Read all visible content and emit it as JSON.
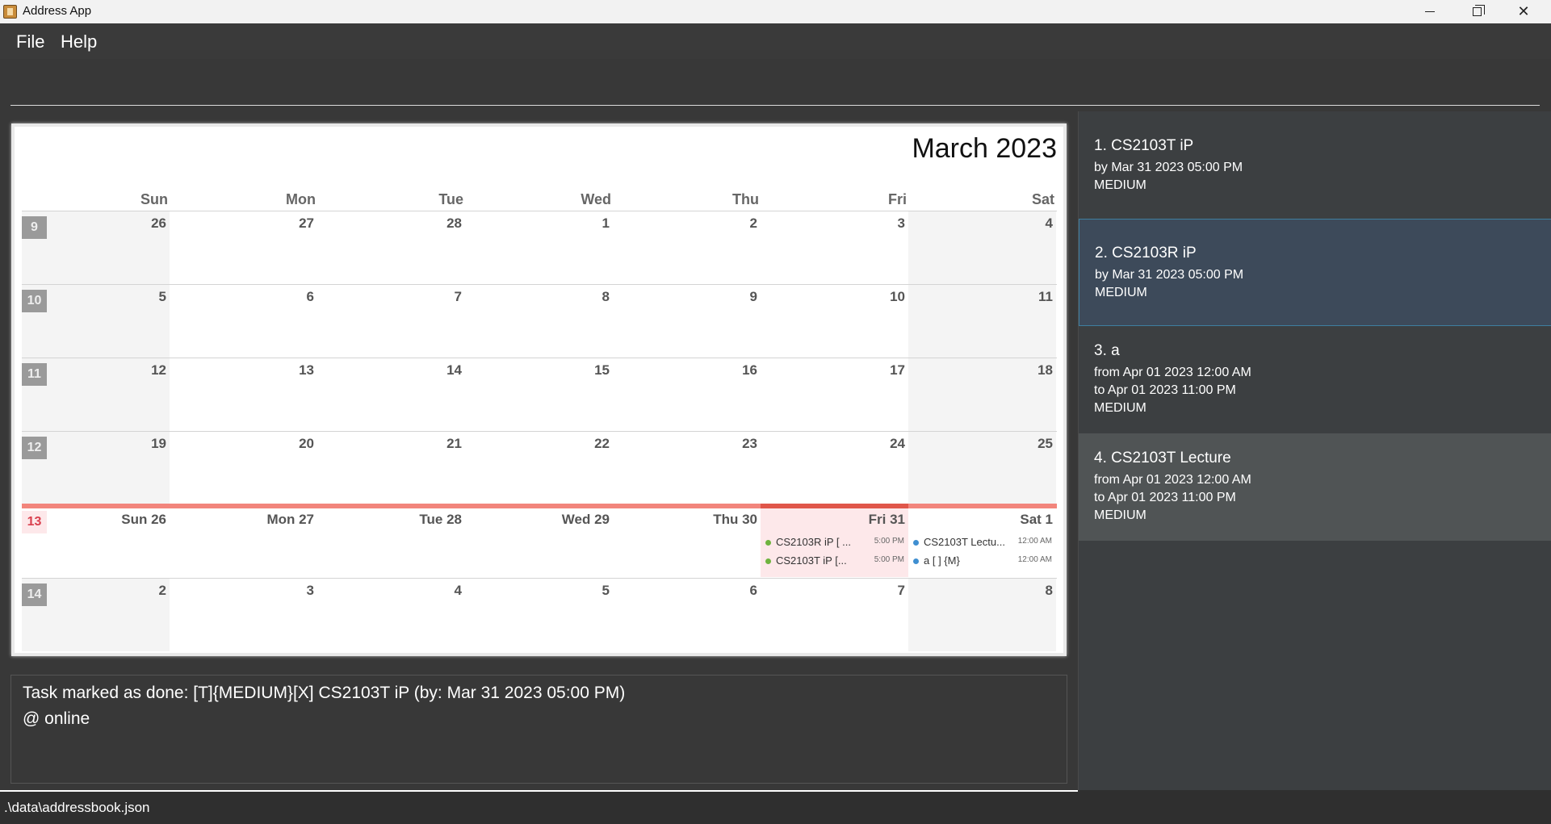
{
  "window": {
    "title": "Address App",
    "minimize_icon": "minimize-icon",
    "maximize_icon": "restore-icon",
    "close_label": "✕"
  },
  "menu": {
    "file": "File",
    "help": "Help"
  },
  "command": {
    "value": ""
  },
  "calendar": {
    "title": "March 2023",
    "day_headers": [
      "Sun",
      "Mon",
      "Tue",
      "Wed",
      "Thu",
      "Fri",
      "Sat"
    ],
    "weeks": [
      {
        "week": "9",
        "days": [
          "26",
          "27",
          "28",
          "1",
          "2",
          "3",
          "4"
        ]
      },
      {
        "week": "10",
        "days": [
          "5",
          "6",
          "7",
          "8",
          "9",
          "10",
          "11"
        ]
      },
      {
        "week": "11",
        "days": [
          "12",
          "13",
          "14",
          "15",
          "16",
          "17",
          "18"
        ]
      },
      {
        "week": "12",
        "days": [
          "19",
          "20",
          "21",
          "22",
          "23",
          "24",
          "25"
        ]
      },
      {
        "week": "13",
        "days": [
          "Sun 26",
          "Mon 27",
          "Tue 28",
          "Wed 29",
          "Thu 30",
          "Fri 31",
          "Sat 1"
        ]
      },
      {
        "week": "14",
        "days": [
          "2",
          "3",
          "4",
          "5",
          "6",
          "7",
          "8"
        ]
      }
    ],
    "events": {
      "fri31": [
        {
          "name": "CS2103R iP   [ ...",
          "time": "5:00 PM",
          "color": "#6fb33f"
        },
        {
          "name": "CS2103T iP   [...",
          "time": "5:00 PM",
          "color": "#6fb33f"
        }
      ],
      "sat1": [
        {
          "name": "CS2103T Lectu...",
          "time": "12:00 AM",
          "color": "#3f8fd1"
        },
        {
          "name": "a      [ ] {M}",
          "time": "12:00 AM",
          "color": "#3f8fd1"
        }
      ]
    }
  },
  "result": {
    "line1": "Task marked as done: [T]{MEDIUM}[X] CS2103T iP (by: Mar 31 2023 05:00 PM)",
    "line2": "@ online"
  },
  "tasks": [
    {
      "title": "1.  CS2103T iP",
      "lines": [
        "by Mar 31 2023 05:00 PM",
        "MEDIUM"
      ]
    },
    {
      "title": "2.  CS2103R iP",
      "lines": [
        "by Mar 31 2023 05:00 PM",
        "MEDIUM"
      ]
    },
    {
      "title": "3.  a",
      "lines": [
        "from Apr 01 2023 12:00 AM",
        "to Apr 01 2023 11:00 PM",
        "MEDIUM"
      ]
    },
    {
      "title": "4.  CS2103T Lecture",
      "lines": [
        "from Apr 01 2023 12:00 AM",
        "to Apr 01 2023 11:00 PM",
        "MEDIUM"
      ]
    }
  ],
  "status": {
    "path": ".\\data\\addressbook.json"
  }
}
